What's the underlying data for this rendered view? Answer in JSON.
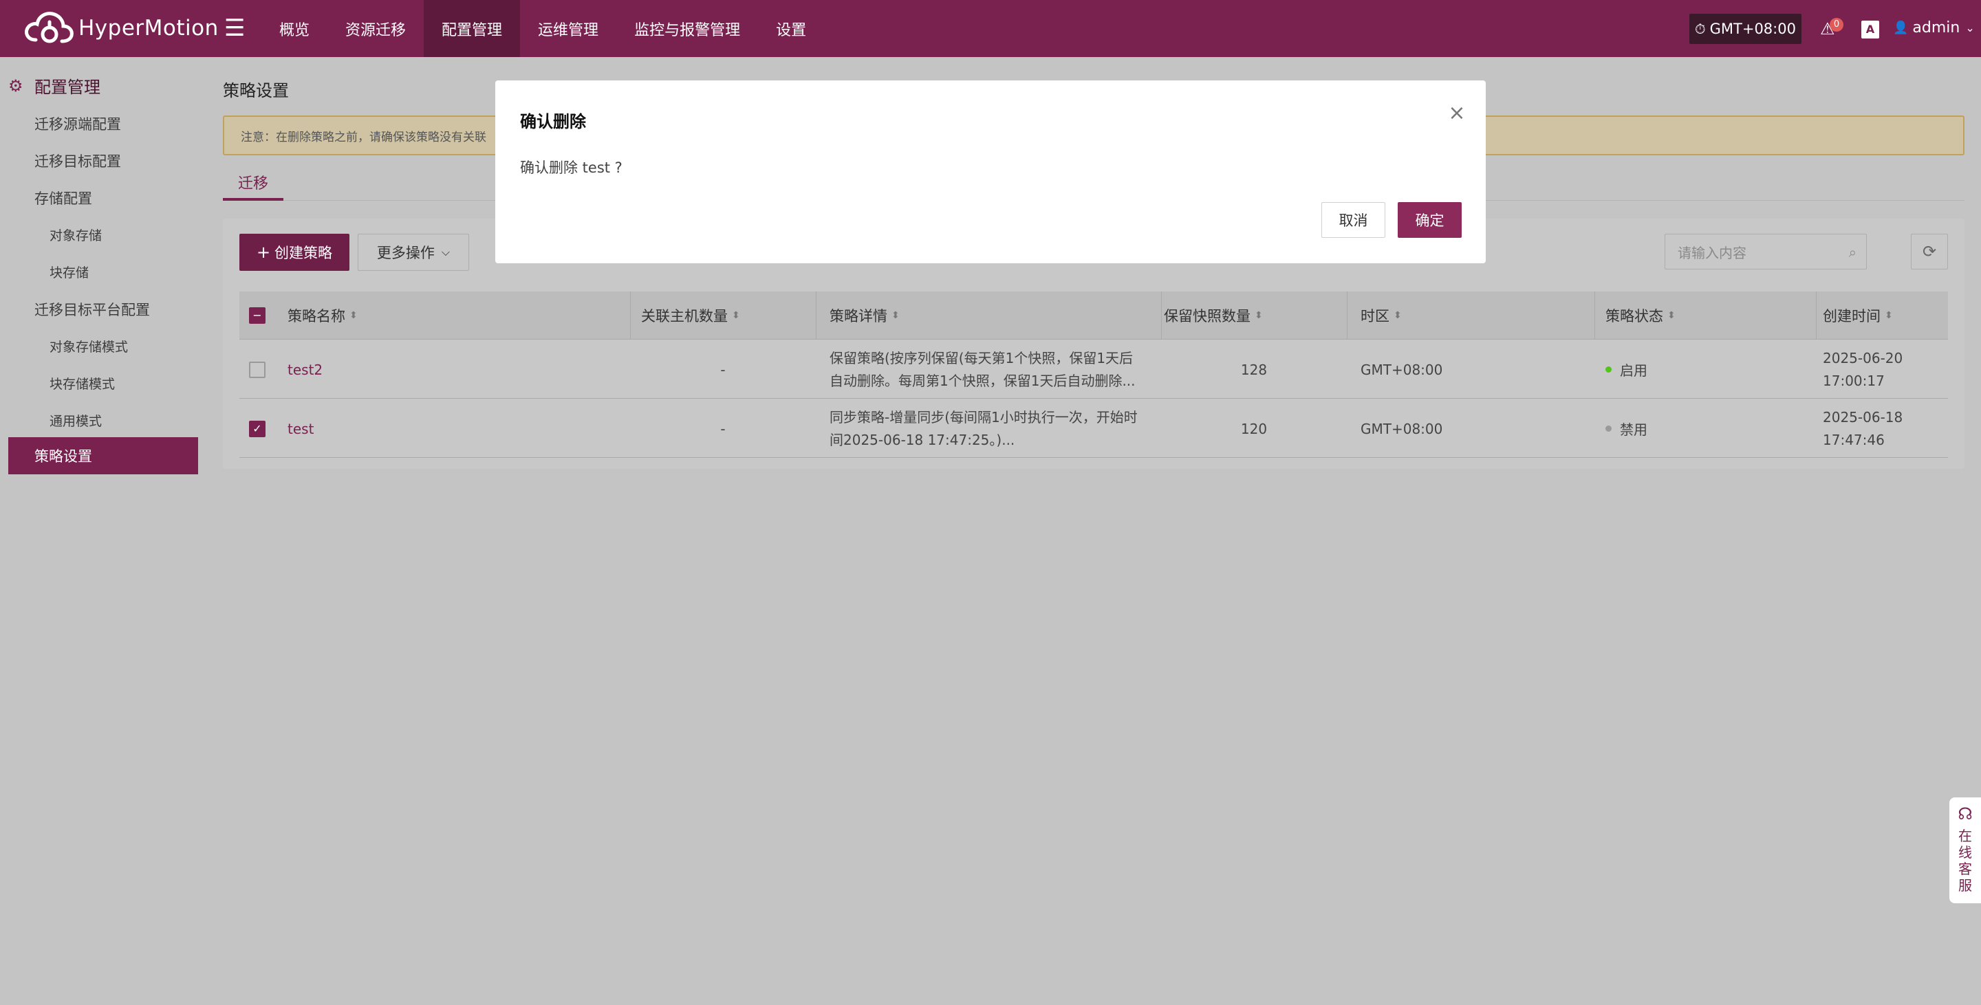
{
  "app": {
    "name": "HyperMotion"
  },
  "nav": {
    "items": [
      "概览",
      "资源迁移",
      "配置管理",
      "运维管理",
      "监控与报警管理",
      "设置"
    ],
    "active": "配置管理"
  },
  "header": {
    "timezone": "GMT+08:00",
    "alert_count": "0",
    "lang_icon": "A",
    "user": "admin"
  },
  "sidebar": {
    "title": "配置管理",
    "items": [
      {
        "label": "迁移源端配置",
        "level": 1
      },
      {
        "label": "迁移目标配置",
        "level": 1
      },
      {
        "label": "存储配置",
        "level": 1
      },
      {
        "label": "对象存储",
        "level": 2
      },
      {
        "label": "块存储",
        "level": 2
      },
      {
        "label": "迁移目标平台配置",
        "level": 1
      },
      {
        "label": "对象存储模式",
        "level": 2
      },
      {
        "label": "块存储模式",
        "level": 2
      },
      {
        "label": "通用模式",
        "level": 2
      },
      {
        "label": "策略设置",
        "level": 1
      }
    ]
  },
  "main": {
    "title": "策略设置",
    "notice": "注意：在删除策略之前，请确保该策略没有关联",
    "tabs": [
      "迁移"
    ],
    "toolbar": {
      "create": "创建策略",
      "more": "更多操作",
      "search_placeholder": "请输入内容"
    },
    "table": {
      "columns": [
        "策略名称",
        "关联主机数量",
        "策略详情",
        "保留快照数量",
        "时区",
        "策略状态",
        "创建时间"
      ],
      "rows": [
        {
          "checked": false,
          "name": "test2",
          "hosts": "-",
          "detail_line1": "保留策略(按序列保留(每天第1个快照，保留1天后",
          "detail_line2": "自动删除。每周第1个快照，保留1天后自动删除...",
          "snapshots": "128",
          "timezone": "GMT+08:00",
          "status": "启用",
          "status_color": "#52c41a",
          "created_date": "2025-06-20",
          "created_time": "17:00:17"
        },
        {
          "checked": true,
          "name": "test",
          "hosts": "-",
          "detail_line1": "同步策略-增量同步(每间隔1小时执行一次，开始时",
          "detail_line2": "间2025-06-18 17:47:25。)...",
          "snapshots": "120",
          "timezone": "GMT+08:00",
          "status": "禁用",
          "status_color": "#9a9a9a",
          "created_date": "2025-06-18",
          "created_time": "17:47:46"
        }
      ]
    }
  },
  "modal": {
    "title": "确认删除",
    "body": "确认删除 test ?",
    "cancel": "取消",
    "ok": "确定"
  },
  "support": {
    "label": "在线客服"
  },
  "colors": {
    "brand": "#79214f",
    "overlay": "#c4c4c4"
  }
}
